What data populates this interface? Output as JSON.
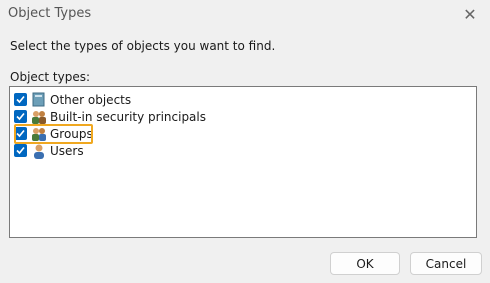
{
  "window": {
    "title": "Object Types"
  },
  "instruction": "Select the types of objects you want to find.",
  "list_label": "Object types:",
  "items": [
    {
      "label": "Other objects",
      "checked": true,
      "icon": "folder-icon"
    },
    {
      "label": "Built-in security principals",
      "checked": true,
      "icon": "group-icon"
    },
    {
      "label": "Groups",
      "checked": true,
      "icon": "group-icon",
      "highlighted": true
    },
    {
      "label": "Users",
      "checked": true,
      "icon": "user-icon"
    }
  ],
  "buttons": {
    "ok": "OK",
    "cancel": "Cancel"
  },
  "colors": {
    "checkbox": "#0067c0",
    "highlight": "#f0a820"
  }
}
